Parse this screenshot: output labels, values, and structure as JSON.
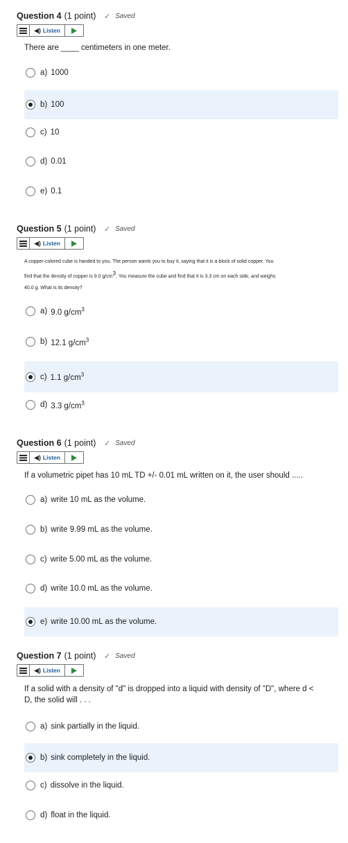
{
  "common": {
    "saved_label": "Saved",
    "listen_label": "Listen"
  },
  "questions": [
    {
      "title": "Question 4",
      "points": "(1 point)",
      "prompt": "There are ____ centimeters in one meter.",
      "options": [
        {
          "letter": "a)",
          "text": "1000",
          "selected": false
        },
        {
          "letter": "b)",
          "text": "100",
          "selected": true
        },
        {
          "letter": "c)",
          "text": "10",
          "selected": false
        },
        {
          "letter": "d)",
          "text": "0.01",
          "selected": false
        },
        {
          "letter": "e)",
          "text": "0.1",
          "selected": false
        }
      ]
    },
    {
      "title": "Question 5",
      "points": "(1 point)",
      "prompt_lines": [
        "A copper-colored cube is handed to you. The person wants you to buy it, saying that it is a block of solid copper. You",
        "find that the density of copper is 9.0 g/cm",
        ". You measure the cube and find that it is 3.3 cm on each side, and weighs",
        "40.0 g. What is its density?"
      ],
      "options": [
        {
          "letter": "a)",
          "text": "9.0 g/cm",
          "sup": "3",
          "selected": false
        },
        {
          "letter": "b)",
          "text": "12.1 g/cm",
          "sup": "3",
          "selected": false
        },
        {
          "letter": "c)",
          "text": "1.1 g/cm",
          "sup": "3",
          "selected": true
        },
        {
          "letter": "d)",
          "text": "3.3 g/cm",
          "sup": "3",
          "selected": false
        }
      ]
    },
    {
      "title": "Question 6",
      "points": "(1 point)",
      "prompt": "If a volumetric pipet has 10 mL TD +/- 0.01 mL written on it, the user should .....",
      "options": [
        {
          "letter": "a)",
          "text": "write 10 mL as the volume.",
          "selected": false
        },
        {
          "letter": "b)",
          "text": "write 9.99 mL as the volume.",
          "selected": false
        },
        {
          "letter": "c)",
          "text": "write 5.00 mL as the volume.",
          "selected": false
        },
        {
          "letter": "d)",
          "text": "write 10.0 mL as the volume.",
          "selected": false
        },
        {
          "letter": "e)",
          "text": "write 10.00 mL as the volume.",
          "selected": true
        }
      ]
    },
    {
      "title": "Question 7",
      "points": "(1 point)",
      "prompt_lines": [
        "If a solid with a density of \"d\" is dropped into a liquid with density of \"D\", where d <",
        "D, the solid will . . ."
      ],
      "options": [
        {
          "letter": "a)",
          "text": "sink partially in the liquid.",
          "selected": false
        },
        {
          "letter": "b)",
          "text": "sink completely in the liquid.",
          "selected": true
        },
        {
          "letter": "c)",
          "text": "dissolve in the liquid.",
          "selected": false
        },
        {
          "letter": "d)",
          "text": "float in the liquid.",
          "selected": false
        }
      ]
    }
  ]
}
